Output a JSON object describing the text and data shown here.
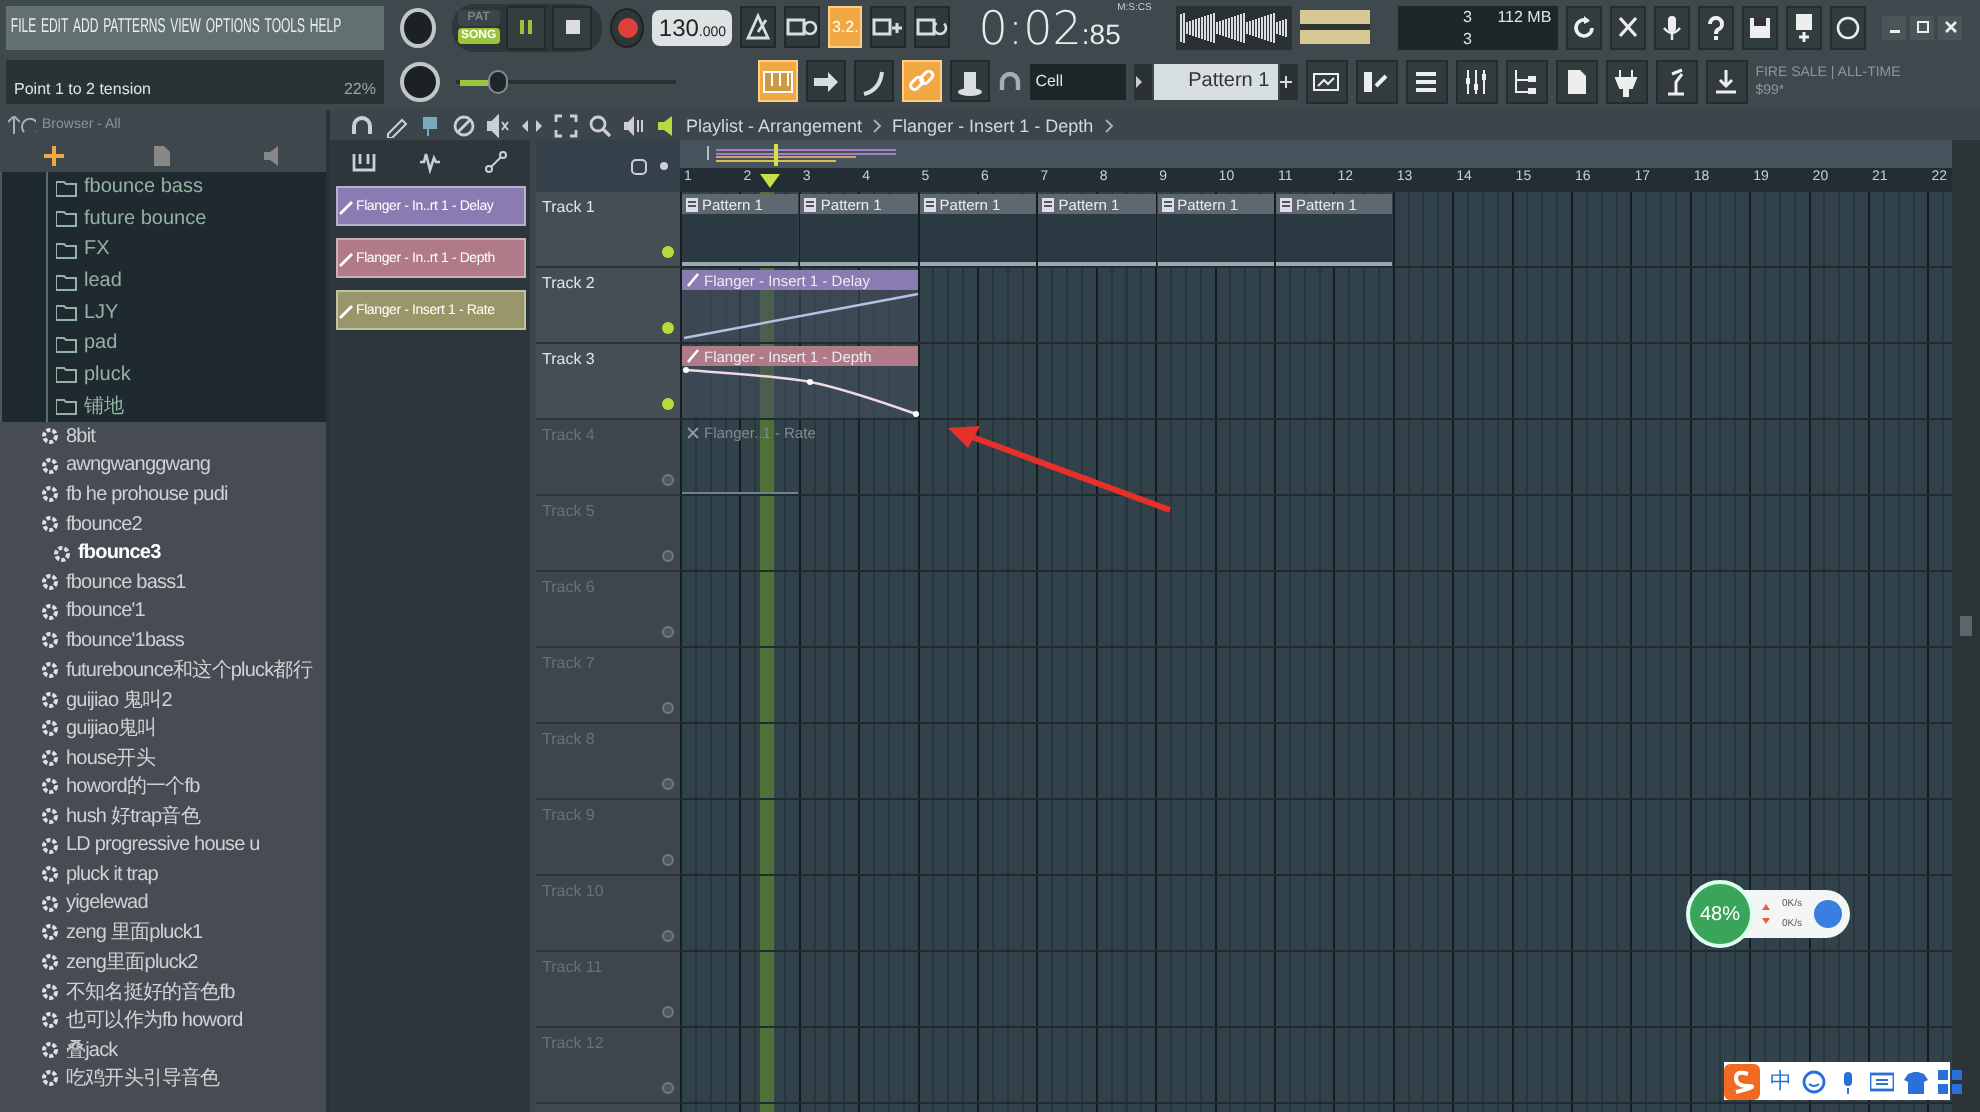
{
  "menu": [
    "FILE",
    "EDIT",
    "ADD",
    "PATTERNS",
    "VIEW",
    "OPTIONS",
    "TOOLS",
    "HELP"
  ],
  "modes": [
    {
      "label": "PAT",
      "selected": false
    },
    {
      "label": "SONG",
      "selected": true
    }
  ],
  "playing": true,
  "tempo": {
    "value": "130",
    "decimals": ".000"
  },
  "record_tools": [
    {
      "kind": "metronome",
      "on": false
    },
    {
      "kind": "wait",
      "on": false
    },
    {
      "kind": "countdown",
      "label": "3.2.",
      "on": true
    },
    {
      "kind": "step",
      "on": false
    },
    {
      "kind": "loop",
      "on": false
    }
  ],
  "time": {
    "unit": "M:S:CS",
    "main": "0:02",
    "sub": ":85"
  },
  "cpu": {
    "cpu": "3",
    "memory": "112 MB",
    "polyphony": "3"
  },
  "hint": {
    "text": "Point 1 to 2 tension",
    "value": "22%"
  },
  "snap_tools": [
    {
      "kind": "keyboard",
      "on": true
    },
    {
      "kind": "arrow",
      "on": false
    },
    {
      "kind": "curve",
      "on": false
    },
    {
      "kind": "link",
      "on": true
    },
    {
      "kind": "hat",
      "on": false
    }
  ],
  "snap": "Cell",
  "pattern": "Pattern 1",
  "news": {
    "headline": "FIRE SALE | ALL-TIME",
    "price": "$99*"
  },
  "browser": {
    "title": "Browser - All",
    "folders": [
      "fbounce bass",
      "future bounce",
      "FX",
      "lead",
      "LJY",
      "pad",
      "pluck",
      "铺地"
    ],
    "presets": [
      {
        "name": "8bit",
        "selected": false
      },
      {
        "name": "awngwanggwang",
        "selected": false
      },
      {
        "name": "fb he prohouse pudi",
        "selected": false
      },
      {
        "name": "fbounce2",
        "selected": false
      },
      {
        "name": "fbounce3",
        "selected": true
      },
      {
        "name": "fbounce bass1",
        "selected": false
      },
      {
        "name": "fbounce'1",
        "selected": false
      },
      {
        "name": "fbounce'1bass",
        "selected": false
      },
      {
        "name": "futurebounce和这个pluck都行",
        "selected": false
      },
      {
        "name": "guijiao 鬼叫2",
        "selected": false
      },
      {
        "name": "guijiao鬼叫",
        "selected": false
      },
      {
        "name": "house开头",
        "selected": false
      },
      {
        "name": "howord的一个fb",
        "selected": false
      },
      {
        "name": "hush 好trap音色",
        "selected": false
      },
      {
        "name": "LD progressive house u",
        "selected": false
      },
      {
        "name": "pluck it trap",
        "selected": false
      },
      {
        "name": "yigelewad",
        "selected": false
      },
      {
        "name": "zeng 里面pluck1",
        "selected": false
      },
      {
        "name": "zeng里面pluck2",
        "selected": false
      },
      {
        "name": "不知名挺好的音色fb",
        "selected": false
      },
      {
        "name": "也可以作为fb howord",
        "selected": false
      },
      {
        "name": "叠jack",
        "selected": false
      },
      {
        "name": "吃鸡开头引导音色",
        "selected": false
      }
    ]
  },
  "clip_sources": [
    {
      "name": "Flanger - In..rt 1 - Delay",
      "color": "#8a7bb2"
    },
    {
      "name": "Flanger - In..rt 1 - Depth",
      "color": "#b07a88"
    },
    {
      "name": "Flanger - Insert 1 - Rate",
      "color": "#99976a"
    }
  ],
  "playlist": {
    "title": "Playlist - Arrangement",
    "clip": "Flanger - Insert 1 - Depth",
    "ruler": [
      "1",
      "2",
      "3",
      "4",
      "5",
      "6",
      "7",
      "8",
      "9",
      "10",
      "11",
      "12",
      "13",
      "14",
      "15",
      "16",
      "17",
      "18",
      "19",
      "20",
      "21",
      "22"
    ],
    "tracks": [
      {
        "name": "Track 1",
        "active": true,
        "clips": [
          {
            "kind": "pattern",
            "label": "Pattern 1",
            "color": "#5f686e"
          },
          {
            "kind": "pattern",
            "label": "Pattern 1",
            "color": "#5f686e"
          },
          {
            "kind": "pattern",
            "label": "Pattern 1",
            "color": "#5f686e"
          },
          {
            "kind": "pattern",
            "label": "Pattern 1",
            "color": "#5f686e"
          },
          {
            "kind": "pattern",
            "label": "Pattern 1",
            "color": "#5f686e"
          },
          {
            "kind": "pattern",
            "label": "Pattern 1",
            "color": "#5f686e"
          }
        ]
      },
      {
        "name": "Track 2",
        "active": true,
        "clips": [
          {
            "kind": "ramp",
            "label": "Flanger - Insert 1 - Delay",
            "color": "#8a7bb2"
          }
        ]
      },
      {
        "name": "Track 3",
        "active": true,
        "clips": [
          {
            "kind": "curve",
            "label": "Flanger - Insert 1 - Depth",
            "color": "#b07a88"
          }
        ]
      },
      {
        "name": "Track 4",
        "active": false,
        "clips": [
          {
            "kind": "ghost",
            "label": "Flanger..1 - Rate"
          }
        ]
      },
      {
        "name": "Track 5",
        "active": false
      },
      {
        "name": "Track 6",
        "active": false
      },
      {
        "name": "Track 7",
        "active": false
      },
      {
        "name": "Track 8",
        "active": false
      },
      {
        "name": "Track 9",
        "active": false
      },
      {
        "name": "Track 10",
        "active": false
      },
      {
        "name": "Track 11",
        "active": false
      },
      {
        "name": "Track 12",
        "active": false
      }
    ]
  },
  "netspeed": {
    "percent": "48%",
    "upload": "0K/s",
    "download": "0K/s"
  },
  "ime": {
    "label": "中"
  }
}
